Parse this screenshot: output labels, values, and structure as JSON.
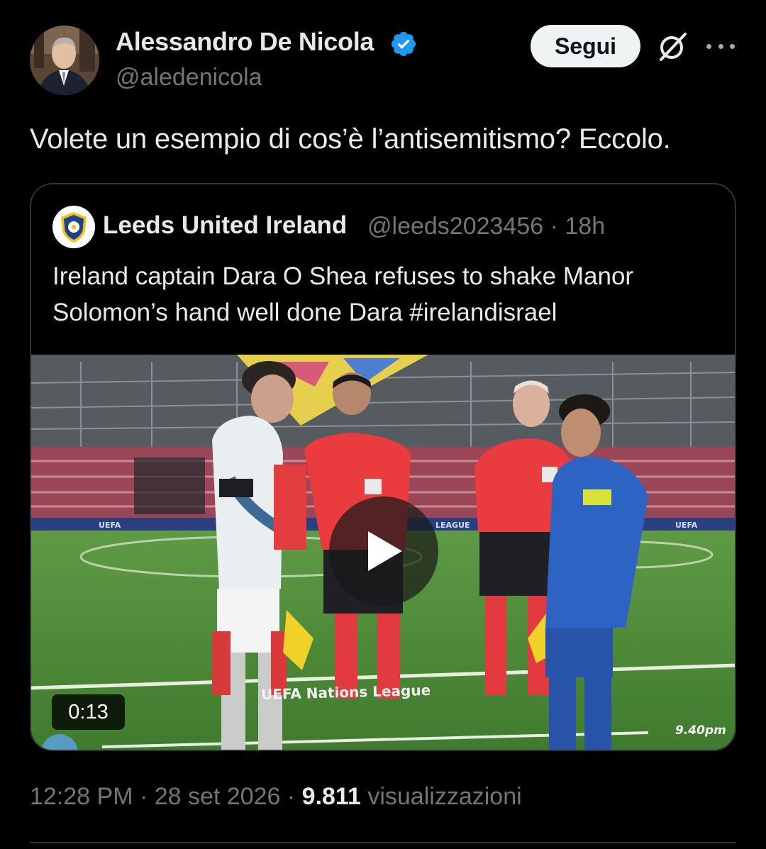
{
  "author": {
    "name": "Alessandro De Nicola",
    "handle": "@aledenicola",
    "verified": true
  },
  "actions": {
    "follow_label": "Segui",
    "grok_icon": "grok-icon",
    "more_icon": "more-icon"
  },
  "tweet": {
    "text": "Volete un esempio di cos’è l’antisemitismo? Eccolo."
  },
  "quoted": {
    "name": "Leeds United Ireland",
    "meta": "@leeds2023456 · 18h",
    "text": "Ireland captain Dara O Shea refuses to shake Manor Solomon’s hand well done  Dara #irelandisrael",
    "media": {
      "duration": "0:13",
      "overlay_title": "UEFA Nations League",
      "overlay_time": "9.40pm",
      "board_texts": [
        "UEFA",
        "LEAGUE",
        "UEFA"
      ]
    }
  },
  "footer": {
    "time_date": "12:28 PM · 28 set 2026 · ",
    "views_count": "9.811",
    "views_label": " visualizzazioni"
  },
  "colors": {
    "background": "#000000",
    "text_primary": "#e7e9ea",
    "text_secondary": "#71767b",
    "verified_blue": "#1d9bf0",
    "border": "#2f3336"
  }
}
